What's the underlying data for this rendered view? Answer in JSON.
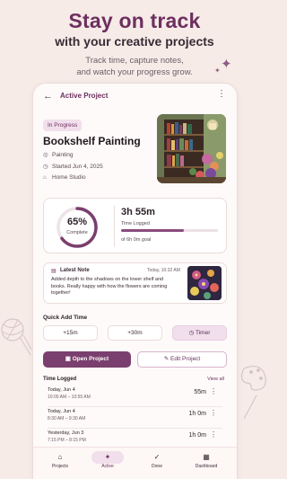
{
  "hero": {
    "title": "Stay on track",
    "subtitle": "with your creative projects",
    "desc_line1": "Track time, capture notes,",
    "desc_line2": "and watch your progress grow."
  },
  "topbar": {
    "title": "Active Project"
  },
  "project": {
    "status": "In Progress",
    "title": "Bookshelf Painting",
    "category": "Painting",
    "started": "Started Jun 4, 2025",
    "location": "Home Studio"
  },
  "progress": {
    "percent_text": "65%",
    "percent_value": 65,
    "complete_label": "Complete",
    "time_logged": "3h 55m",
    "time_logged_label": "Time Logged",
    "goal_fraction": 0.65,
    "goal_text": "of 6h 0m goal"
  },
  "note": {
    "title": "Latest Note",
    "date": "Today, 10:32 AM",
    "body": "Added depth to the shadows on the lower shelf and books. Really happy with how the flowers are coming together!"
  },
  "quick_add": {
    "label": "Quick Add Time",
    "btn1": "+15m",
    "btn2": "+30m",
    "btn3": "Timer"
  },
  "actions": {
    "open": "Open Project",
    "edit": "Edit Project"
  },
  "time_log": {
    "header": "Time Logged",
    "view_all": "View all",
    "entries": [
      {
        "date": "Today, Jun 4",
        "range": "10:00 AM – 10:55 AM",
        "duration": "55m"
      },
      {
        "date": "Today, Jun 4",
        "range": "8:30 AM – 9:30 AM",
        "duration": "1h 0m"
      },
      {
        "date": "Yesterday, Jun 3",
        "range": "7:15 PM – 8:15 PM",
        "duration": "1h 0m"
      }
    ]
  },
  "nav": {
    "projects": "Projects",
    "active": "Active",
    "done": "Done",
    "dashboard": "Dashboard"
  },
  "colors": {
    "accent": "#6d2f5f",
    "accent_soft": "#f1dfec",
    "button": "#7a3f6e",
    "background": "#f6ebe7"
  }
}
